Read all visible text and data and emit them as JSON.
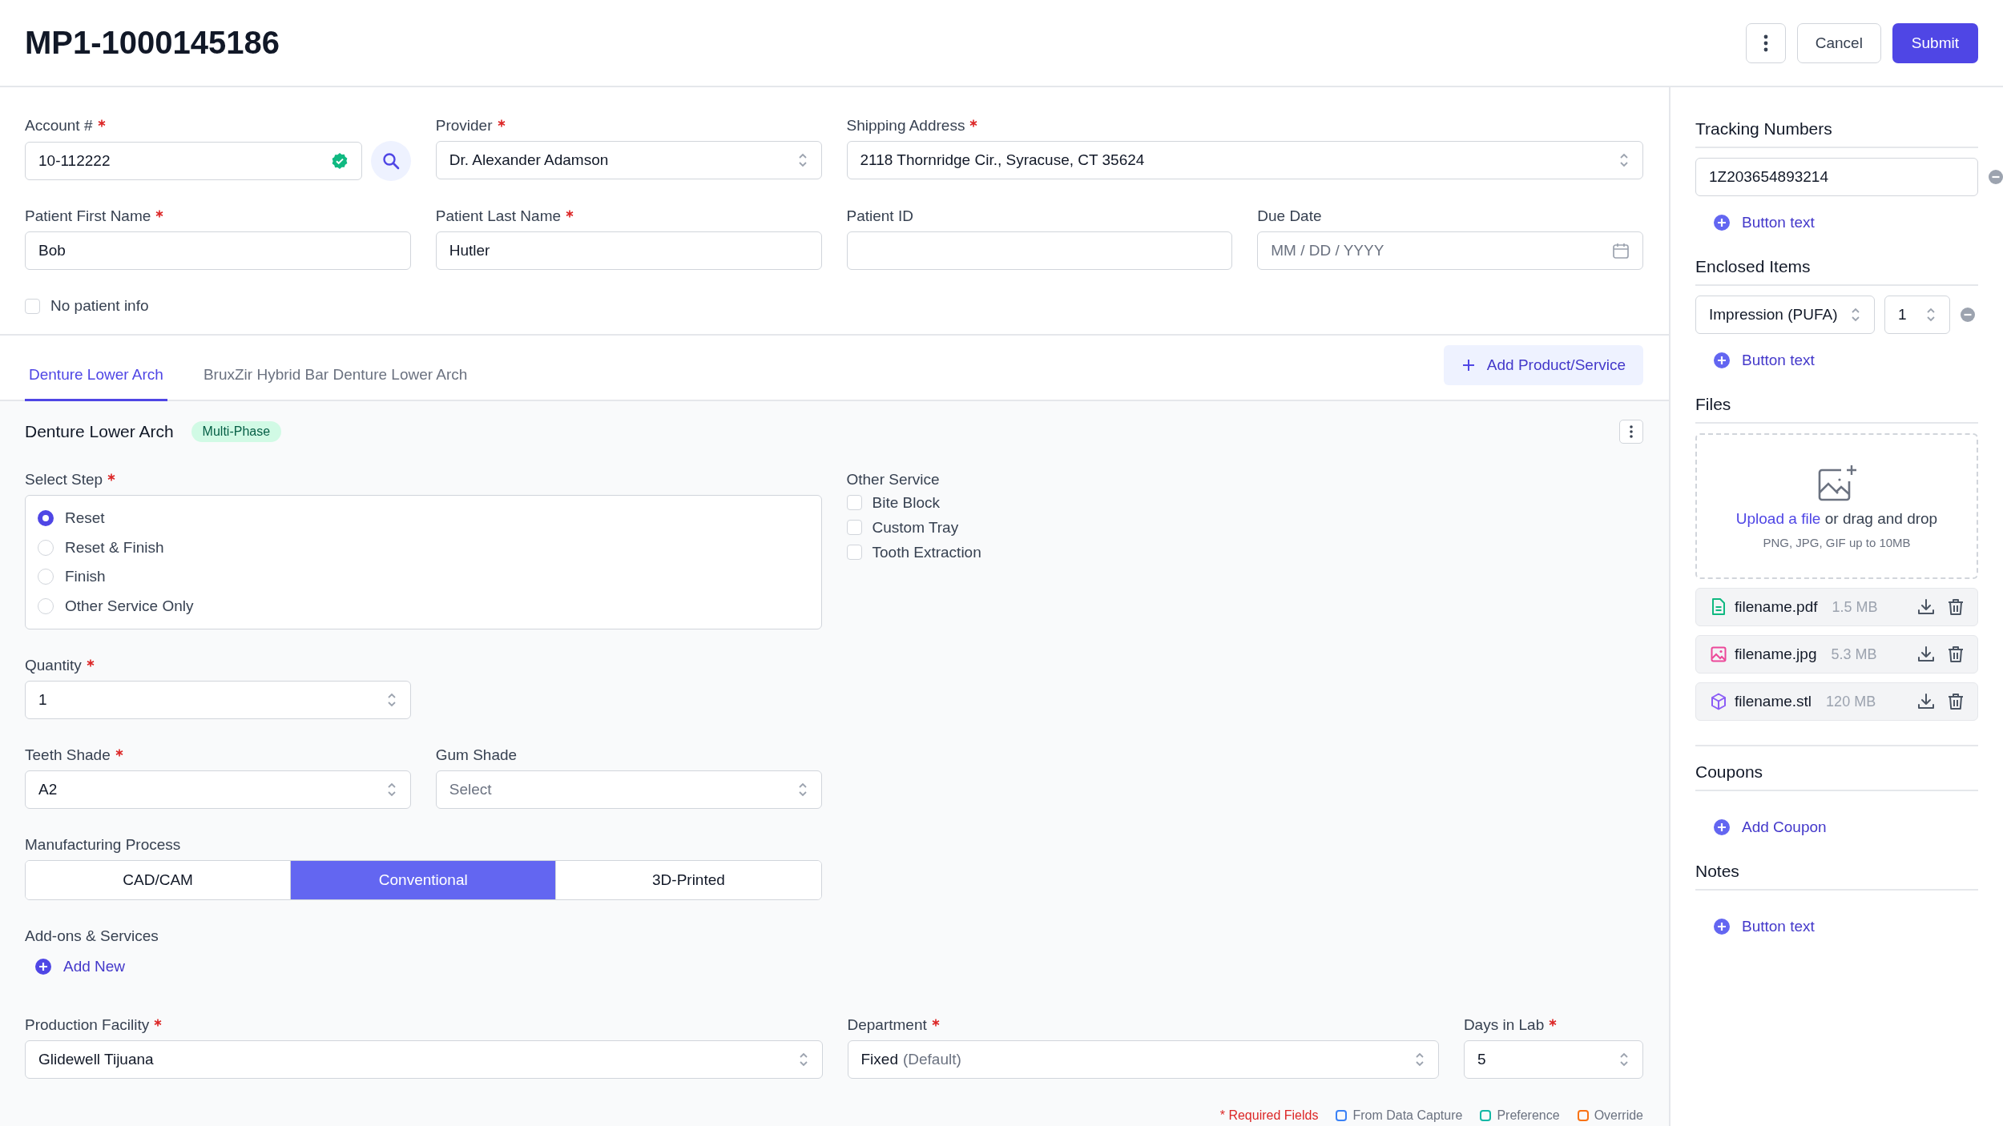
{
  "header": {
    "title": "MP1-1000145186",
    "buttons": [
      {
        "label": "Cancel",
        "kind": "secondary"
      },
      {
        "label": "Submit",
        "kind": "primary"
      }
    ]
  },
  "top_fields": [
    {
      "kind": "account",
      "label": "Account #",
      "required": true,
      "value": "10-112222",
      "verified": true
    },
    {
      "kind": "select",
      "label": "Provider",
      "required": true,
      "value": "Dr. Alexander Adamson"
    },
    {
      "kind": "select",
      "label": "Shipping Address",
      "required": true,
      "value": "2118 Thornridge Cir., Syracuse, CT 35624"
    },
    {
      "kind": "text",
      "label": "Patient First Name",
      "required": true,
      "value": "Bob"
    },
    {
      "kind": "text",
      "label": "Patient Last Name",
      "required": true,
      "value": "Hutler"
    },
    {
      "kind": "text",
      "label": "Patient ID",
      "required": false
    },
    {
      "kind": "date",
      "label": "Due Date",
      "required": false,
      "placeholder": "MM / DD / YYYY"
    }
  ],
  "no_patient_info": {
    "label": "No patient info",
    "checked": false
  },
  "tabs": [
    {
      "label": "Denture Lower Arch",
      "selected": true
    },
    {
      "label": "BruxZir Hybrid Bar Denture Lower Arch",
      "selected": false
    }
  ],
  "add_product": "Add Product/Service",
  "product": {
    "title": "Denture Lower Arch",
    "badge": "Multi-Phase",
    "fields": [
      {
        "kind": "radio",
        "label": "Select Step",
        "required": true,
        "options": [
          {
            "label": "Reset",
            "selected": true
          },
          {
            "label": "Reset & Finish",
            "selected": false
          },
          {
            "label": "Finish",
            "selected": false
          },
          {
            "label": "Other Service Only",
            "selected": false
          }
        ]
      },
      {
        "kind": "checks",
        "label": "Other Service",
        "required": false,
        "options": [
          {
            "label": "Bite Block",
            "checked": false
          },
          {
            "label": "Custom Tray",
            "checked": false
          },
          {
            "label": "Tooth Extraction",
            "checked": false
          }
        ]
      },
      {
        "kind": "select",
        "label": "Quantity",
        "required": true,
        "value": "1"
      },
      {
        "kind": "select",
        "label": "Teeth Shade",
        "required": true,
        "value": "A2"
      },
      {
        "kind": "select",
        "label": "Gum Shade",
        "required": false,
        "placeholder": "Select"
      },
      {
        "kind": "segmented",
        "label": "Manufacturing Process",
        "required": false,
        "options": [
          {
            "label": "CAD/CAM",
            "selected": false
          },
          {
            "label": "Conventional",
            "selected": true
          },
          {
            "label": "3D-Printed",
            "selected": false
          }
        ]
      },
      {
        "kind": "add",
        "label": "Add-ons & Services",
        "required": false,
        "button": "Add New"
      }
    ],
    "bottom_fields": [
      {
        "label": "Production Facility",
        "required": true,
        "value": "Glidewell Tijuana"
      },
      {
        "label": "Department",
        "required": true,
        "value": "Fixed",
        "note": "(Default)"
      },
      {
        "label": "Days in Lab",
        "required": true,
        "value": "5"
      }
    ]
  },
  "legend": {
    "required": "* Required Fields",
    "items": [
      {
        "label": "From Data Capture",
        "color": "#3b82f6"
      },
      {
        "label": "Preference",
        "color": "#14b8a6"
      },
      {
        "label": "Override",
        "color": "#f97316"
      }
    ]
  },
  "sidebar": {
    "tracking": {
      "heading": "Tracking Numbers",
      "values": [
        "1Z203654893214"
      ],
      "button": "Button text"
    },
    "enclosed": {
      "heading": "Enclosed Items",
      "items": [
        {
          "item": "Impression (PUFA)",
          "quantity": "1"
        }
      ],
      "button": "Button text"
    },
    "files": {
      "heading": "Files",
      "upload_link": "Upload a file",
      "upload_text": "or drag and drop",
      "hint": "PNG, JPG, GIF up to 10MB",
      "items": [
        {
          "name": "filename.pdf",
          "size": "1.5 MB",
          "kind": "document"
        },
        {
          "name": "filename.jpg",
          "size": "5.3 MB",
          "kind": "image"
        },
        {
          "name": "filename.stl",
          "size": "120 MB",
          "kind": "model"
        }
      ]
    },
    "coupons": {
      "heading": "Coupons",
      "button": "Add Coupon"
    },
    "notes": {
      "heading": "Notes",
      "button": "Button text"
    }
  }
}
